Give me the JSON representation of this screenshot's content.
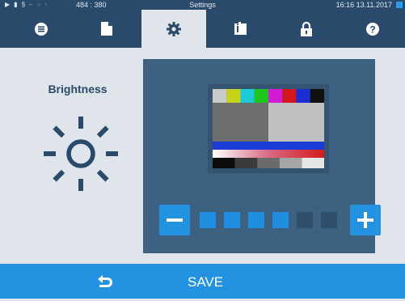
{
  "statusbar": {
    "coords": "484 : 380",
    "title": "Settings",
    "datetime": "16:16  13.11.2017",
    "icons": [
      "play-icon",
      "document-icon",
      "heat-icon",
      "chart-icon",
      "clock-icon",
      "lock-icon"
    ]
  },
  "tabs": [
    {
      "icon": "list-icon",
      "active": false
    },
    {
      "icon": "document-icon",
      "active": false
    },
    {
      "icon": "gear-icon",
      "active": true
    },
    {
      "icon": "info-book-icon",
      "active": false
    },
    {
      "icon": "lock-icon",
      "active": false
    },
    {
      "icon": "help-icon",
      "active": false
    }
  ],
  "brightness": {
    "label": "Brightness",
    "level": 4,
    "max_level": 6
  },
  "footer": {
    "save_label": "SAVE",
    "back_icon": "back-arrow-icon"
  },
  "colors": {
    "header_bg": "#2a4a6b",
    "accent": "#2393e1",
    "panel_bg": "#3d6180",
    "level_on": "#1f8ee0",
    "level_off": "#2f4e69"
  }
}
